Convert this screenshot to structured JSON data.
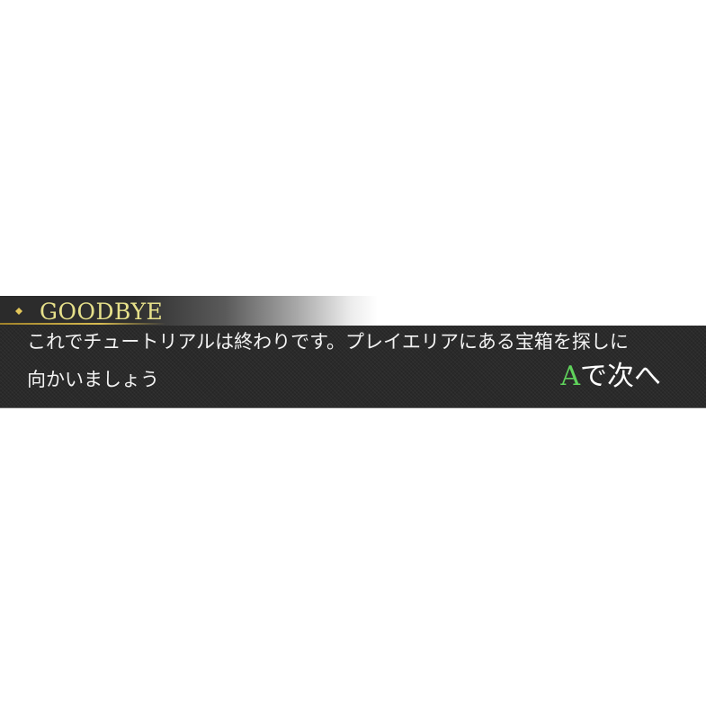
{
  "dialog": {
    "title": "GOODBYE",
    "lines": [
      "これでチュートリアルは終わりです。プレイエリアにある宝箱を探しに",
      "向かいましょう"
    ],
    "advance_prompt": {
      "button": "A",
      "text": "で次へ"
    },
    "colors": {
      "title_text": "#e6e08a",
      "title_rule": "#d8bc52",
      "panel_bg": "#2a2a2a",
      "message_text": "#f2f2f2",
      "button_letter": "#5fd25b"
    },
    "title_icon": "diamond-icon"
  }
}
